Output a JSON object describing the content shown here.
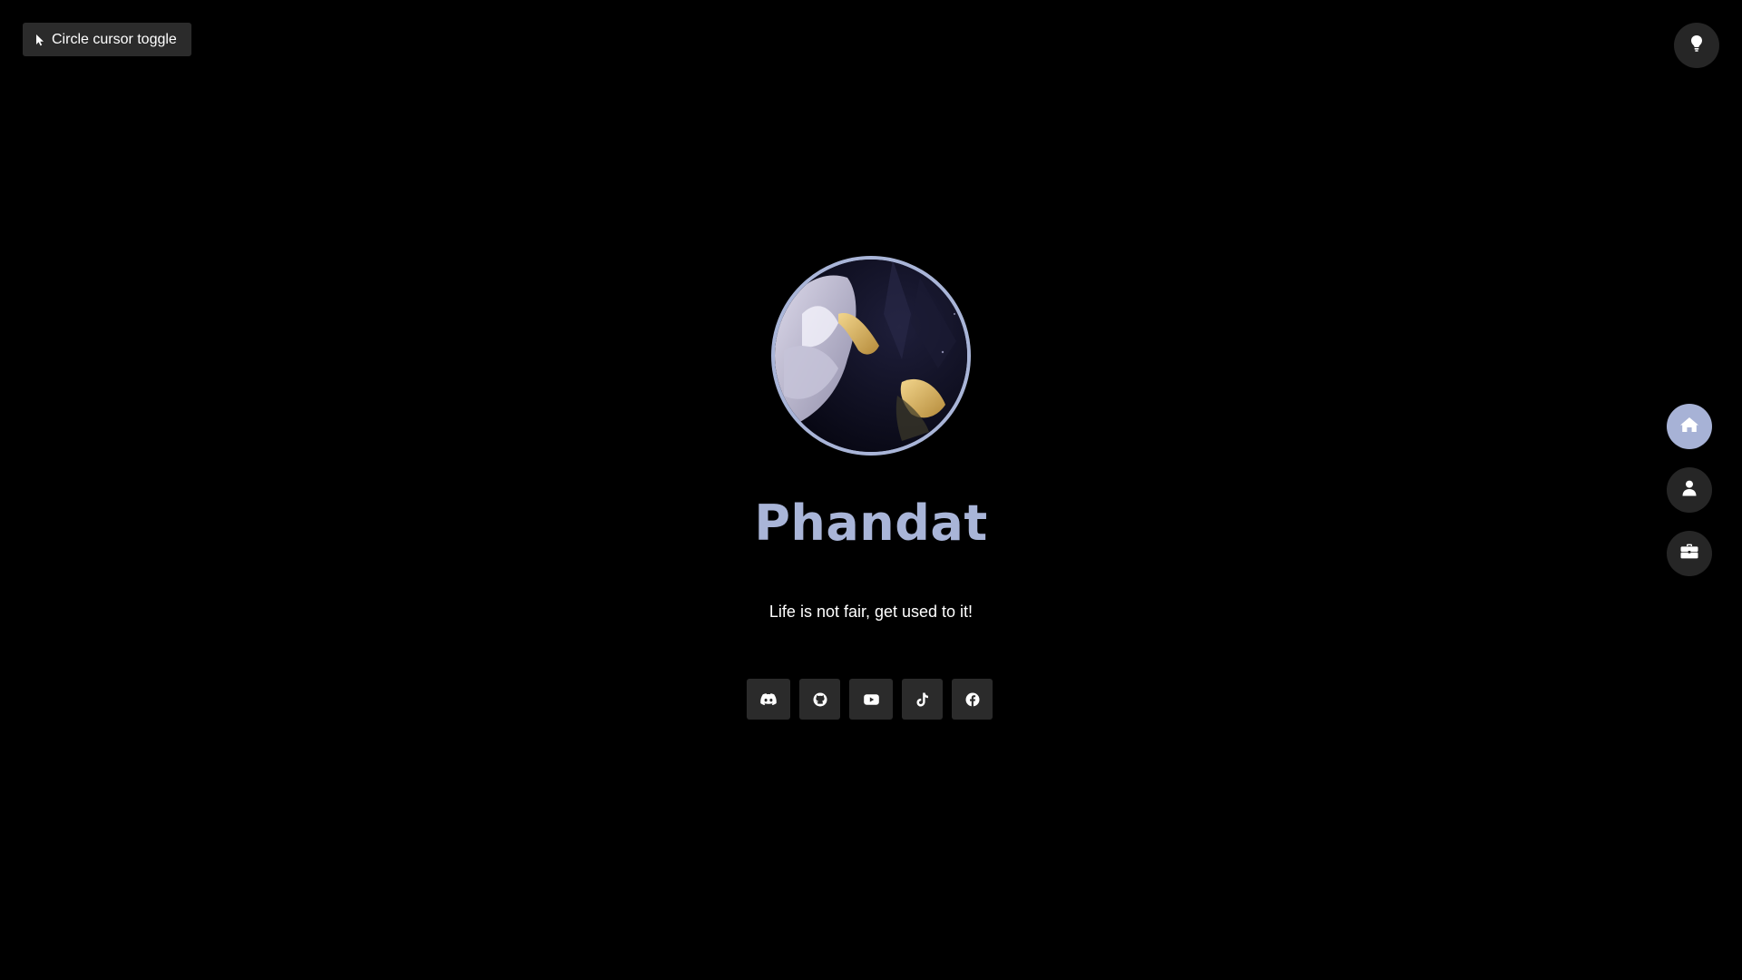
{
  "cursor_toggle": {
    "label": "Circle cursor toggle",
    "icon": "pointer-cursor-icon"
  },
  "theme_toggle": {
    "icon": "lightbulb-icon"
  },
  "side_nav": [
    {
      "icon": "home-icon",
      "active": true
    },
    {
      "icon": "user-icon",
      "active": false
    },
    {
      "icon": "briefcase-icon",
      "active": false
    }
  ],
  "profile": {
    "name": "Phandat",
    "tagline": "Life is not fair, get used to it!"
  },
  "socials": [
    {
      "icon": "discord-icon"
    },
    {
      "icon": "github-icon"
    },
    {
      "icon": "youtube-icon"
    },
    {
      "icon": "tiktok-icon"
    },
    {
      "icon": "facebook-icon"
    }
  ],
  "colors": {
    "background": "#000000",
    "accent": "#a9b5d8",
    "button_bg": "#2b2b2b",
    "nav_active": "#a7b2d6"
  }
}
